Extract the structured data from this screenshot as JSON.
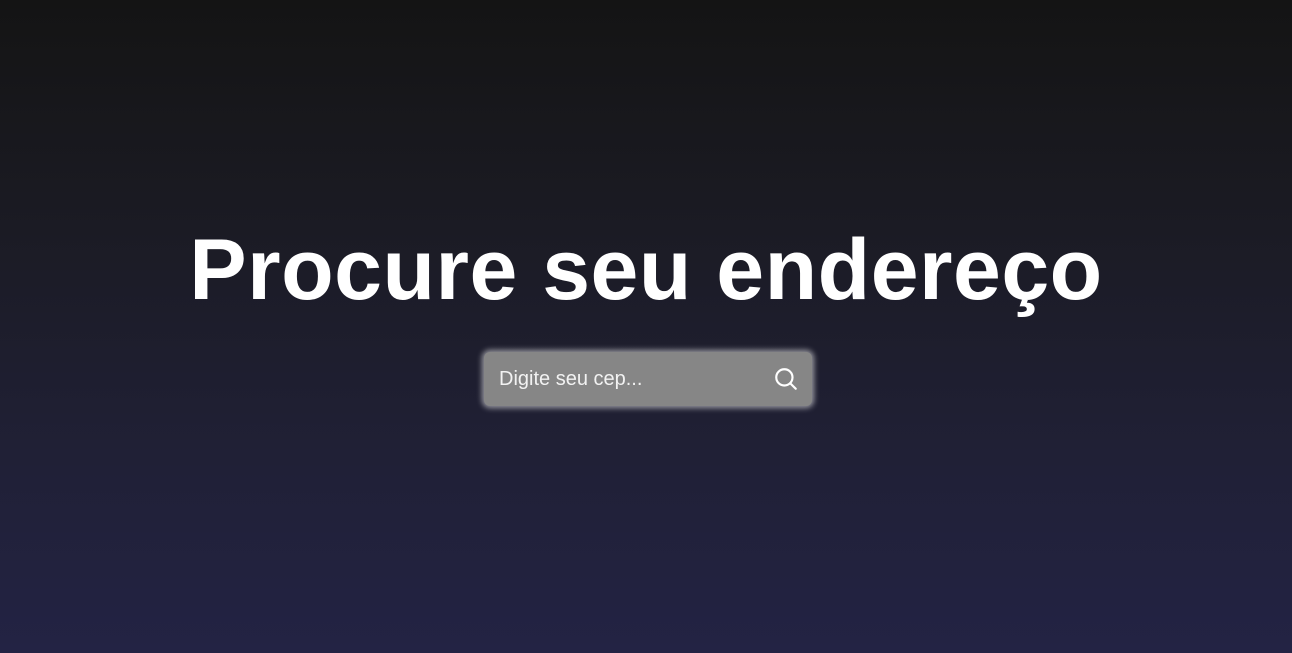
{
  "page": {
    "title": "Procure seu endereço"
  },
  "search": {
    "placeholder": "Digite seu cep...",
    "value": "",
    "button_icon": "search-icon"
  },
  "colors": {
    "background_top": "#141414",
    "background_bottom": "#232344",
    "title_text": "#ffffff",
    "input_background": "#868686",
    "input_text": "#f2f2f2"
  }
}
